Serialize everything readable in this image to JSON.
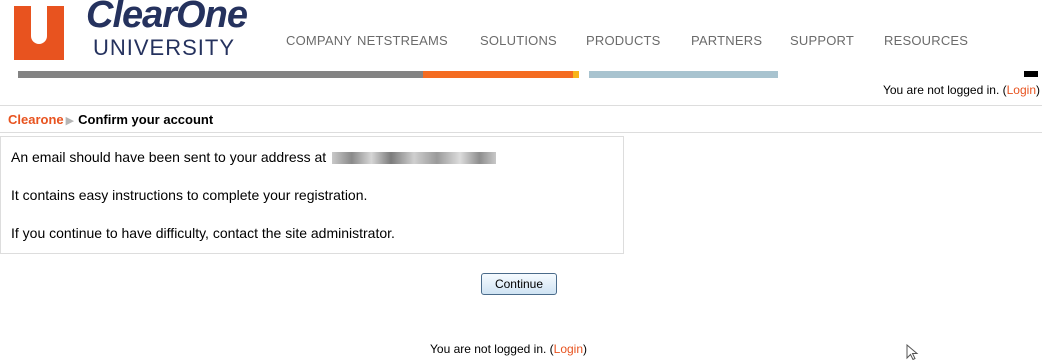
{
  "logo": {
    "brand": "ClearOne",
    "sub": "UNIVERSITY"
  },
  "nav": {
    "items": [
      {
        "label": "COMPANY"
      },
      {
        "label": "NETSTREAMS"
      },
      {
        "label": "SOLUTIONS"
      },
      {
        "label": "PRODUCTS"
      },
      {
        "label": "PARTNERS"
      },
      {
        "label": "SUPPORT"
      },
      {
        "label": "RESOURCES"
      }
    ]
  },
  "colors": {
    "accent": "#e8531f",
    "brand_navy": "#25325e",
    "bar_gray": "#838383",
    "bar_orange": "#f46b21",
    "bar_yellow": "#f7b51a",
    "bar_blue": "#a8c3cf"
  },
  "login_status": {
    "text": "You are not logged in. (",
    "link": "Login",
    "close": ")"
  },
  "breadcrumb": {
    "home": "Clearone",
    "separator_icon": "triangle-right-icon",
    "current": "Confirm your account"
  },
  "message": {
    "line1": "An email should have been sent to your address at",
    "line2": "It contains easy instructions to complete your registration.",
    "line3": "If you continue to have difficulty, contact the site administrator."
  },
  "buttons": {
    "continue": "Continue"
  },
  "footer": {
    "text": "You are not logged in. (",
    "link": "Login",
    "close": ")"
  },
  "icons": {
    "cursor": "mouse-pointer-icon"
  }
}
